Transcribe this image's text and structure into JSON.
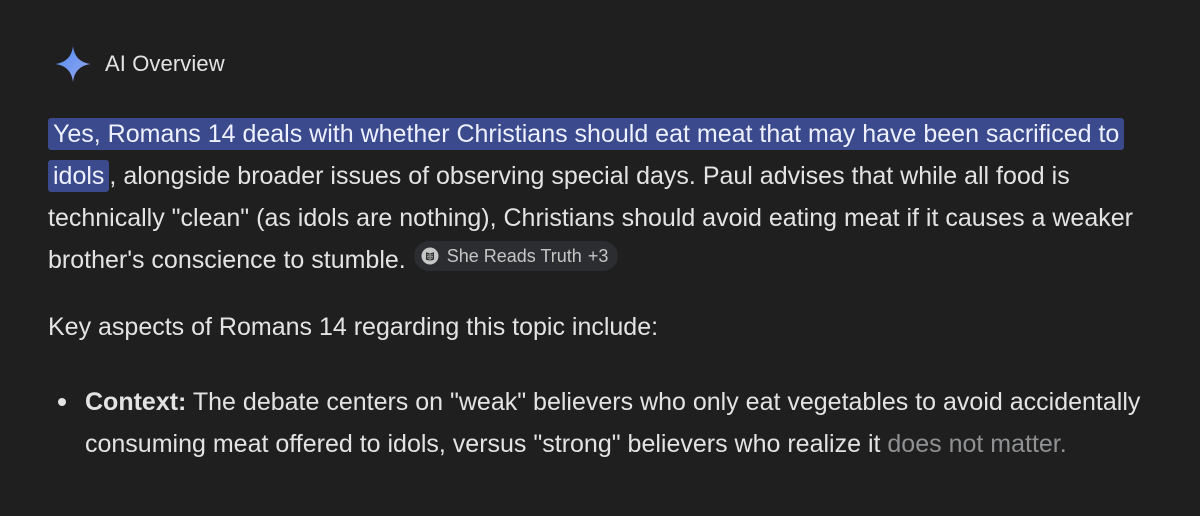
{
  "header": {
    "title": "AI Overview",
    "icon": "sparkle-icon",
    "icon_color": "#8ab4f8"
  },
  "paragraph": {
    "highlighted": "Yes, Romans 14 deals with whether Christians should eat meat that may have been sacrificed to idols",
    "rest": ", alongside broader issues of observing special days. Paul advises that while all food is technically \"clean\" (as idols are nothing), Christians should avoid eating meat if it causes a weaker brother's conscience to stumble.",
    "highlight_color": "#3a4a8c"
  },
  "source_chip": {
    "label": "She Reads Truth",
    "more": "+3",
    "icon": "book-icon"
  },
  "key_aspects": {
    "intro": "Key aspects of Romans 14 regarding this topic include:"
  },
  "bullets": [
    {
      "label": "Context:",
      "text": " The debate centers on \"weak\" believers who only eat vegetables to avoid accidentally consuming meat offered to idols, versus \"strong\" believers who realize it ",
      "faded_text": "does not matter."
    }
  ]
}
